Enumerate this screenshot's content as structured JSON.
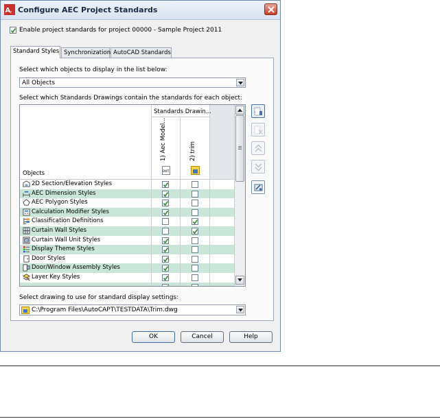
{
  "window": {
    "title": "Configure AEC Project Standards"
  },
  "enable": {
    "label": "Enable project standards for project 00000 - Sample Project 2011",
    "checked": true
  },
  "tabs": [
    {
      "label": "Standard Styles",
      "active": true
    },
    {
      "label": "Synchronization",
      "active": false
    },
    {
      "label": "AutoCAD Standards",
      "active": false
    }
  ],
  "objects_filter": {
    "label": "Select which objects to display in the list below:",
    "value": "All Objects"
  },
  "drawings_label": "Select which Standards Drawings contain the standards for each object:",
  "grid": {
    "group_header": "Standards Drawin...",
    "objects_header": "Objects",
    "columns": [
      {
        "label": "1) Aec Model...",
        "badge": "DWT"
      },
      {
        "label": "2) trim"
      }
    ],
    "rows": [
      {
        "name": "2D Section/Elevation Styles",
        "icon": "section-elevation-icon",
        "c1": true,
        "c2": false,
        "alt": false
      },
      {
        "name": "AEC Dimension Styles",
        "icon": "dimension-icon",
        "c1": true,
        "c2": false,
        "alt": true
      },
      {
        "name": "AEC Polygon Styles",
        "icon": "polygon-icon",
        "c1": true,
        "c2": false,
        "alt": false
      },
      {
        "name": "Calculation Modifier Styles",
        "icon": "calculator-icon",
        "c1": true,
        "c2": false,
        "alt": true
      },
      {
        "name": "Classification Definitions",
        "icon": "classification-icon",
        "c1": false,
        "c2": true,
        "alt": false
      },
      {
        "name": "Curtain Wall Styles",
        "icon": "curtain-wall-icon",
        "c1": false,
        "c2": true,
        "alt": true
      },
      {
        "name": "Curtain Wall Unit Styles",
        "icon": "curtain-wall-unit-icon",
        "c1": true,
        "c2": false,
        "alt": false
      },
      {
        "name": "Display Theme Styles",
        "icon": "display-theme-icon",
        "c1": true,
        "c2": false,
        "alt": true
      },
      {
        "name": "Door Styles",
        "icon": "door-icon",
        "c1": true,
        "c2": false,
        "alt": false
      },
      {
        "name": "Door/Window Assembly Styles",
        "icon": "door-window-icon",
        "c1": true,
        "c2": false,
        "alt": true
      },
      {
        "name": "Layer Key Styles",
        "icon": "layer-key-icon",
        "c1": true,
        "c2": false,
        "alt": false
      }
    ]
  },
  "display_drawing": {
    "label": "Select drawing to use for standard display settings:",
    "value": "C:\\Program Files\\AutoCAPT\\TESTDATA\\Trim.dwg"
  },
  "buttons": {
    "ok": "OK",
    "cancel": "Cancel",
    "help": "Help"
  },
  "colors": {
    "row_alt": "#c9e6d9",
    "check": "#2f8a2f",
    "accent": "#4b6f9e"
  }
}
